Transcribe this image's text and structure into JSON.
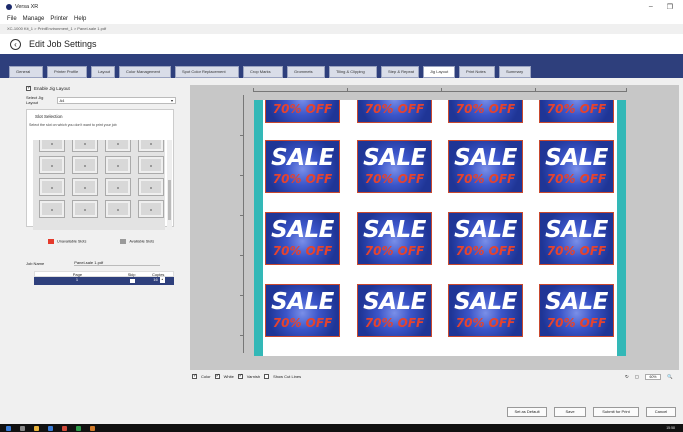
{
  "window": {
    "app_title": "Versa XR",
    "controls": [
      "–",
      "❐"
    ]
  },
  "menu": [
    "File",
    "Manage",
    "Printer",
    "Help"
  ],
  "breadcrumb": "XC-1000 Kit_1 > PrintEnvironment_1 > Panel-sale 1.pdf",
  "page_title": "Edit Job Settings",
  "tabs": [
    "General",
    "Printer Profile",
    "Layout",
    "Color Management",
    "Spot Color Replacement",
    "Crop Marks",
    "Grommets",
    "Tiling & Clipping",
    "Step & Repeat",
    "Jig Layout",
    "Print Notes",
    "Summary"
  ],
  "active_tab": "Jig Layout",
  "jig": {
    "enable_label": "Enable Jig Layout",
    "enabled": true,
    "select_label": "Select Jig Layout",
    "select_value": "A4",
    "slot_section_label": "Slot Selection",
    "slot_hint": "Select the slot on which you don't want to print your job",
    "legend_unavailable": "Unavailable Slots",
    "legend_available": "Available Slots",
    "colors": {
      "unavailable": "#e53a2b",
      "available": "#9a9a9a"
    }
  },
  "job": {
    "name_label": "Job Name",
    "name_value": "Panel-sale 1.pdf",
    "columns": [
      "Page",
      "Skip",
      "Copies"
    ],
    "row": {
      "page": "1",
      "copies": "16"
    }
  },
  "preview": {
    "tile_line1": "SALE",
    "tile_line2": "70% OFF",
    "colors": {
      "tile_blue": "#2c45b5",
      "tile_red": "#e5432e",
      "edge_teal": "#33b8b7"
    }
  },
  "view_options": [
    {
      "label": "Color",
      "checked": true
    },
    {
      "label": "White",
      "checked": true
    },
    {
      "label": "Varnish",
      "checked": true
    },
    {
      "label": "Show Cut Lines",
      "checked": false
    }
  ],
  "zoom": "60%",
  "buttons": {
    "set_default": "Set as Default",
    "save": "Save",
    "submit": "Submit for Print",
    "cancel": "Cancel"
  },
  "taskbar_clock": "15:58"
}
